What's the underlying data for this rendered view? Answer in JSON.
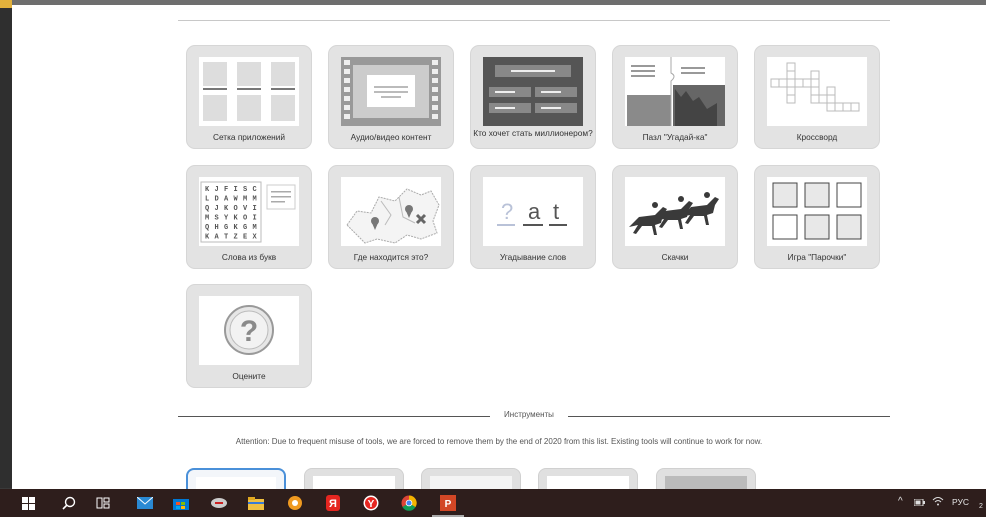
{
  "apps": {
    "row1": [
      {
        "label": "Сетка приложений",
        "icon": "grid-icon"
      },
      {
        "label": "Аудио/видео контент",
        "icon": "film-icon"
      },
      {
        "label": "Кто хочет стать миллионером?",
        "icon": "quiz-icon"
      },
      {
        "label": "Пазл \"Угадай-ка\"",
        "icon": "puzzle-icon"
      },
      {
        "label": "Кроссворд",
        "icon": "crossword-icon"
      }
    ],
    "row2": [
      {
        "label": "Слова из букв",
        "icon": "word-grid-icon"
      },
      {
        "label": "Где находится это?",
        "icon": "map-pin-icon"
      },
      {
        "label": "Угадывание слов",
        "icon": "word-guess-icon"
      },
      {
        "label": "Скачки",
        "icon": "horse-race-icon"
      },
      {
        "label": "Игра \"Парочки\"",
        "icon": "pairs-icon"
      }
    ],
    "row3": [
      {
        "label": "Оцените",
        "icon": "question-icon"
      }
    ]
  },
  "word_guess": {
    "q": "?",
    "l1": "a",
    "l2": "t"
  },
  "letter_grid": [
    "KJFISC",
    "LDAWMM",
    "QJKOVI",
    "MSYKOI",
    "QHGKGM",
    "KATZEX"
  ],
  "tools": {
    "label": "Инструменты",
    "attention": "Attention: Due to frequent misuse of tools, we are forced to remove them by the end of 2020 from this list. Existing tools will continue to work for now."
  },
  "taskbar": {
    "lang": "РУС",
    "clock": "2",
    "icons": [
      "windows-start-icon",
      "search-icon",
      "task-view-icon",
      "mail-icon",
      "store-icon",
      "game-icon",
      "explorer-icon",
      "settings-icon",
      "yandex-browser-icon",
      "yandex-icon",
      "chrome-icon",
      "powerpoint-icon"
    ]
  },
  "colors": {
    "accent": "#4a90d9",
    "tile": "#e3e3e3",
    "taskbar": "#2e1e1c"
  }
}
